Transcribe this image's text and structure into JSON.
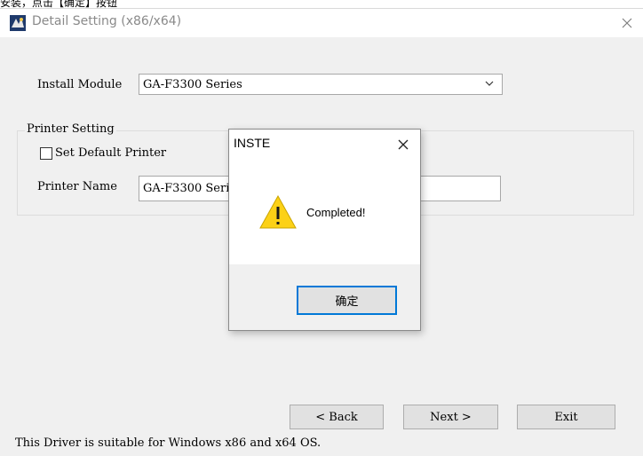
{
  "caption_fragment": "安装，点击【确定】按钮",
  "window": {
    "title": "Detail Setting (x86/x64)",
    "close_icon": "close-icon",
    "app_icon": "app-icon"
  },
  "install": {
    "label": "Install Module",
    "selected": "GA-F3300 Series",
    "dropdown_icon": "chevron-down-icon"
  },
  "printer_setting": {
    "group_title": "Printer Setting",
    "default_label": "Set Default Printer",
    "default_checked": false,
    "name_label": "Printer Name",
    "name_value": "GA-F3300 Series"
  },
  "buttons": {
    "back": "< Back",
    "next": "Next >",
    "exit": "Exit"
  },
  "footer": "This Driver is suitable for Windows x86 and x64 OS.",
  "dialog": {
    "title": "INSTE",
    "message": "Completed!",
    "ok_label": "确定",
    "icon": "warning-icon"
  },
  "colors": {
    "accent": "#0078d7",
    "warning_fill": "#fcd116",
    "window_bg": "#f0f0f0"
  }
}
